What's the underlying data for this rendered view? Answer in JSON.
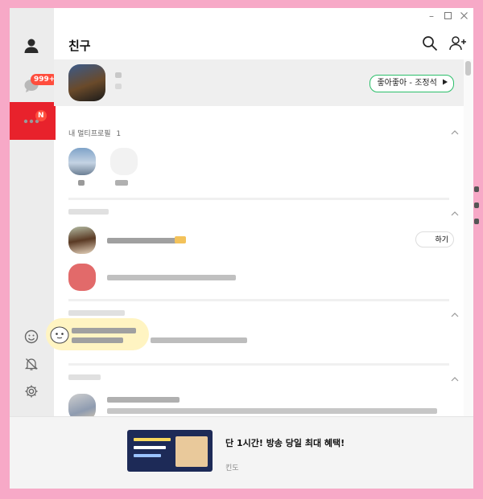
{
  "window": {
    "title": ""
  },
  "sidebar": {
    "chat_badge": "999+",
    "more_badge": "N"
  },
  "header": {
    "title": "친구"
  },
  "profile": {
    "music": "좋아좋아 - 조정석"
  },
  "sections": {
    "multi_profile": {
      "title": "내 멀티프로필",
      "count": "1"
    }
  },
  "friend_rows": {
    "action_label": "하기"
  },
  "ad": {
    "title": "단 1시간! 방송 당일 최대 혜택!",
    "source": "킨도"
  },
  "colors": {
    "accent_red": "#e8222c",
    "pill_border": "#2bbf6a",
    "background": "#f7a9c7"
  },
  "icons": [
    "person-icon",
    "chat-icon",
    "more-icon",
    "emoji-icon",
    "bell-off-icon",
    "gear-icon",
    "search-icon",
    "add-friend-icon",
    "chevron-up-icon",
    "close-icon",
    "maximize-icon",
    "minimize-icon"
  ]
}
